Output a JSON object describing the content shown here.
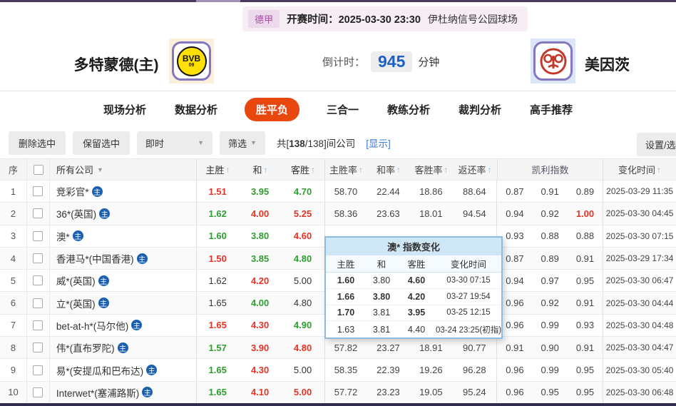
{
  "top": {
    "league": "德甲",
    "kickoff": "开赛时间：2025-03-30 23:30",
    "venue": "伊杜纳信号公园球场"
  },
  "header": {
    "home_name": "多特蒙德(主)",
    "away_name": "美因茨",
    "home_logo_text": "BVB",
    "home_logo_sub": "09",
    "countdown_label": "倒计时：",
    "countdown_value": "945",
    "countdown_unit": "分钟"
  },
  "tabs": [
    {
      "label": "现场分析",
      "active": false
    },
    {
      "label": "数据分析",
      "active": false
    },
    {
      "label": "胜平负",
      "active": true
    },
    {
      "label": "三合一",
      "active": false
    },
    {
      "label": "教练分析",
      "active": false
    },
    {
      "label": "裁判分析",
      "active": false
    },
    {
      "label": "高手推荐",
      "active": false
    }
  ],
  "toolbar": {
    "delete_label": "删除选中",
    "keep_label": "保留选中",
    "instant_label": "即时",
    "filter_label": "筛选",
    "count_prefix": "共[",
    "count_main": "138",
    "count_rest": "/138]间公司",
    "show_link": "[显示]",
    "settings_label": "设置/选择"
  },
  "icons": {
    "sort_up": "↑",
    "dropdown": "▼"
  },
  "table": {
    "headers": {
      "seq": "序",
      "company": "所有公司",
      "home_win": "主胜",
      "draw": "和",
      "away_win": "客胜",
      "home_rate": "主胜率",
      "draw_rate": "和率",
      "away_rate": "客胜率",
      "return_rate": "返还率",
      "kelly": "凯利指数",
      "time": "变化时间"
    },
    "badge_label": "主",
    "rows": [
      {
        "num": "1",
        "company": "竞彩官*",
        "odds": [
          {
            "v": "1.51",
            "c": "red"
          },
          {
            "v": "3.95",
            "c": "green"
          },
          {
            "v": "4.70",
            "c": "green"
          }
        ],
        "rates": [
          "58.70",
          "22.44",
          "18.86",
          "88.64"
        ],
        "kelly": [
          {
            "v": "0.87",
            "c": ""
          },
          {
            "v": "0.91",
            "c": ""
          },
          {
            "v": "0.89",
            "c": ""
          }
        ],
        "time": "2025-03-29 11:35"
      },
      {
        "num": "2",
        "company": "36*(英国)",
        "odds": [
          {
            "v": "1.62",
            "c": "green"
          },
          {
            "v": "4.00",
            "c": "red"
          },
          {
            "v": "5.25",
            "c": "red"
          }
        ],
        "rates": [
          "58.36",
          "23.63",
          "18.01",
          "94.54"
        ],
        "kelly": [
          {
            "v": "0.94",
            "c": ""
          },
          {
            "v": "0.92",
            "c": ""
          },
          {
            "v": "1.00",
            "c": "kred"
          }
        ],
        "time": "2025-03-30 04:45"
      },
      {
        "num": "3",
        "company": "澳*",
        "odds": [
          {
            "v": "1.60",
            "c": "green"
          },
          {
            "v": "3.80",
            "c": "green"
          },
          {
            "v": "4.60",
            "c": "red"
          }
        ],
        "rates": [
          "",
          "",
          "",
          ""
        ],
        "kelly": [
          {
            "v": "0.93",
            "c": ""
          },
          {
            "v": "0.88",
            "c": ""
          },
          {
            "v": "0.88",
            "c": ""
          }
        ],
        "time": "2025-03-30 07:15"
      },
      {
        "num": "4",
        "company": "香港马*(中国香港)",
        "odds": [
          {
            "v": "1.50",
            "c": "red"
          },
          {
            "v": "3.85",
            "c": "green"
          },
          {
            "v": "4.80",
            "c": "green"
          }
        ],
        "rates": [
          "",
          "",
          "",
          ""
        ],
        "kelly": [
          {
            "v": "0.87",
            "c": ""
          },
          {
            "v": "0.89",
            "c": ""
          },
          {
            "v": "0.91",
            "c": ""
          }
        ],
        "time": "2025-03-29 17:34"
      },
      {
        "num": "5",
        "company": "威*(英国)",
        "odds": [
          {
            "v": "1.62",
            "c": "plain"
          },
          {
            "v": "4.20",
            "c": "red"
          },
          {
            "v": "5.00",
            "c": "plain"
          }
        ],
        "rates": [
          "",
          "",
          "",
          ""
        ],
        "kelly": [
          {
            "v": "0.94",
            "c": ""
          },
          {
            "v": "0.97",
            "c": ""
          },
          {
            "v": "0.95",
            "c": ""
          }
        ],
        "time": "2025-03-30 06:47"
      },
      {
        "num": "6",
        "company": "立*(英国)",
        "odds": [
          {
            "v": "1.65",
            "c": "plain"
          },
          {
            "v": "4.00",
            "c": "green"
          },
          {
            "v": "4.80",
            "c": "plain"
          }
        ],
        "rates": [
          "",
          "",
          "",
          ""
        ],
        "kelly": [
          {
            "v": "0.96",
            "c": ""
          },
          {
            "v": "0.92",
            "c": ""
          },
          {
            "v": "0.91",
            "c": ""
          }
        ],
        "time": "2025-03-30 04:44"
      },
      {
        "num": "7",
        "company": "bet-at-h*(马尔他)",
        "odds": [
          {
            "v": "1.65",
            "c": "red"
          },
          {
            "v": "4.30",
            "c": "red"
          },
          {
            "v": "4.90",
            "c": "green"
          }
        ],
        "rates": [
          "",
          "",
          "",
          ""
        ],
        "kelly": [
          {
            "v": "0.96",
            "c": ""
          },
          {
            "v": "0.99",
            "c": ""
          },
          {
            "v": "0.93",
            "c": ""
          }
        ],
        "time": "2025-03-30 04:48"
      },
      {
        "num": "8",
        "company": "伟*(直布罗陀)",
        "odds": [
          {
            "v": "1.57",
            "c": "green"
          },
          {
            "v": "3.90",
            "c": "red"
          },
          {
            "v": "4.80",
            "c": "red"
          }
        ],
        "rates": [
          "57.82",
          "23.27",
          "18.91",
          "90.77"
        ],
        "kelly": [
          {
            "v": "0.91",
            "c": ""
          },
          {
            "v": "0.90",
            "c": ""
          },
          {
            "v": "0.91",
            "c": ""
          }
        ],
        "time": "2025-03-30 04:47"
      },
      {
        "num": "9",
        "company": "易*(安提瓜和巴布达)",
        "odds": [
          {
            "v": "1.65",
            "c": "green"
          },
          {
            "v": "4.30",
            "c": "red"
          },
          {
            "v": "5.00",
            "c": "plain"
          }
        ],
        "rates": [
          "58.35",
          "22.39",
          "19.26",
          "96.28"
        ],
        "kelly": [
          {
            "v": "0.96",
            "c": ""
          },
          {
            "v": "0.99",
            "c": ""
          },
          {
            "v": "0.95",
            "c": ""
          }
        ],
        "time": "2025-03-30 05:40"
      },
      {
        "num": "10",
        "company": "Interwet*(塞浦路斯)",
        "odds": [
          {
            "v": "1.65",
            "c": "green"
          },
          {
            "v": "4.10",
            "c": "red"
          },
          {
            "v": "5.00",
            "c": "red"
          }
        ],
        "rates": [
          "57.72",
          "23.23",
          "19.05",
          "95.24"
        ],
        "kelly": [
          {
            "v": "0.96",
            "c": ""
          },
          {
            "v": "0.95",
            "c": ""
          },
          {
            "v": "0.95",
            "c": ""
          }
        ],
        "time": "2025-03-30 06:48"
      }
    ]
  },
  "popup": {
    "title": "澳* 指数变化",
    "cols": [
      "主胜",
      "和",
      "客胜",
      "变化时间"
    ],
    "rows": [
      {
        "odds": [
          {
            "v": "1.60",
            "c": "green"
          },
          {
            "v": "3.80",
            "c": ""
          },
          {
            "v": "4.60",
            "c": "red"
          }
        ],
        "time": "03-30 07:15"
      },
      {
        "odds": [
          {
            "v": "1.66",
            "c": "green"
          },
          {
            "v": "3.80",
            "c": "green"
          },
          {
            "v": "4.20",
            "c": "red"
          }
        ],
        "time": "03-27 19:54"
      },
      {
        "odds": [
          {
            "v": "1.70",
            "c": "red"
          },
          {
            "v": "3.81",
            "c": ""
          },
          {
            "v": "3.95",
            "c": "green"
          }
        ],
        "time": "03-25 12:15"
      },
      {
        "odds": [
          {
            "v": "1.63",
            "c": ""
          },
          {
            "v": "3.81",
            "c": ""
          },
          {
            "v": "4.40",
            "c": ""
          }
        ],
        "time": "03-24 23:25(初指)"
      }
    ]
  },
  "colors": {
    "odds_up_red": "#e63326",
    "odds_down_green": "#2e9e2e",
    "tab_active_orange": "#e8480e",
    "link_blue": "#3a7bd5",
    "countdown_blue": "#1e5fc8",
    "badge_blue": "#1a5fb0",
    "popup_border_blue": "#8cbbdf",
    "league_chip_purple": "#a44fa4"
  }
}
